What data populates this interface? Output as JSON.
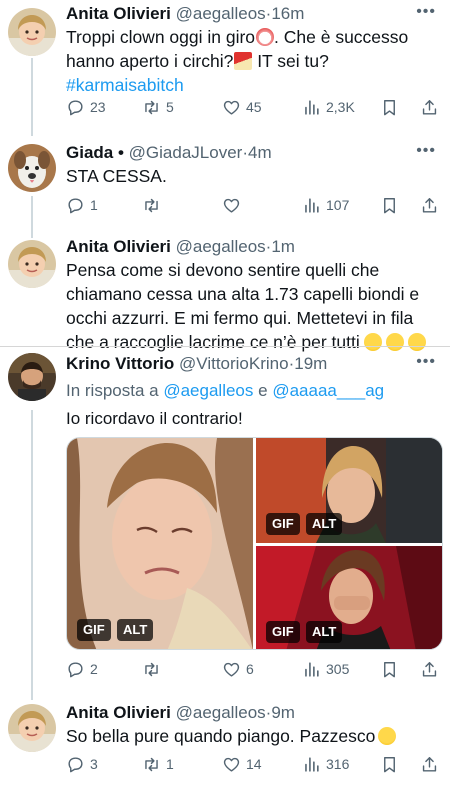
{
  "tweets": [
    {
      "name": "Anita Olivieri",
      "handle": "@aegalleos",
      "sep": "·",
      "time": "16m",
      "line1": "Troppi clown oggi in giro",
      "line1_tail": ". Che è successo",
      "line2": "hanno aperto i circhi?",
      "line2_tail": " IT sei tu?",
      "hashtag": "#karmaisabitch",
      "stats": {
        "replies": "23",
        "retweets": "5",
        "likes": "45",
        "views": "2,3K"
      }
    },
    {
      "name": "Giada",
      "verified_dot": "•",
      "handle": "@GiadaJLover",
      "sep": "·",
      "time": "4m",
      "text": "STA CESSA.",
      "stats": {
        "replies": "1",
        "retweets": "",
        "likes": "",
        "views": "107"
      }
    },
    {
      "name": "Anita Olivieri",
      "handle": "@aegalleos",
      "sep": "·",
      "time": "1m",
      "lines": [
        "Pensa come si devono sentire quelli che",
        "chiamano cessa una alta 1.73 capelli biondi e",
        "occhi azzurri. E mi fermo qui. Mettetevi in fila",
        "che a raccoglie lacrime ce n’è per tutti"
      ]
    },
    {
      "name": "Krino Vittorio",
      "handle": "@VittorioKrino",
      "sep": "·",
      "time": "19m",
      "reply_prefix": "In risposta a",
      "reply_user1": "@aegalleos",
      "reply_and": "e",
      "reply_user2": "@aaaaa___ag",
      "text": "Io ricordavo il contrario!",
      "badges": {
        "gif": "GIF",
        "alt": "ALT"
      },
      "stats": {
        "replies": "2",
        "retweets": "",
        "likes": "6",
        "views": "305"
      }
    },
    {
      "name": "Anita Olivieri",
      "handle": "@aegalleos",
      "sep": "·",
      "time": "9m",
      "text": "So bella pure quando piango. Pazzesco",
      "stats": {
        "replies": "3",
        "retweets": "1",
        "likes": "14",
        "views": "316"
      }
    }
  ],
  "icons": {
    "reply": "reply-icon",
    "retweet": "retweet-icon",
    "like": "like-icon",
    "views": "views-icon",
    "bookmark": "bookmark-icon",
    "share": "share-icon",
    "more": "more-icon"
  },
  "colors": {
    "link": "#1d9bf0",
    "muted": "#536471",
    "text": "#0f1419"
  }
}
